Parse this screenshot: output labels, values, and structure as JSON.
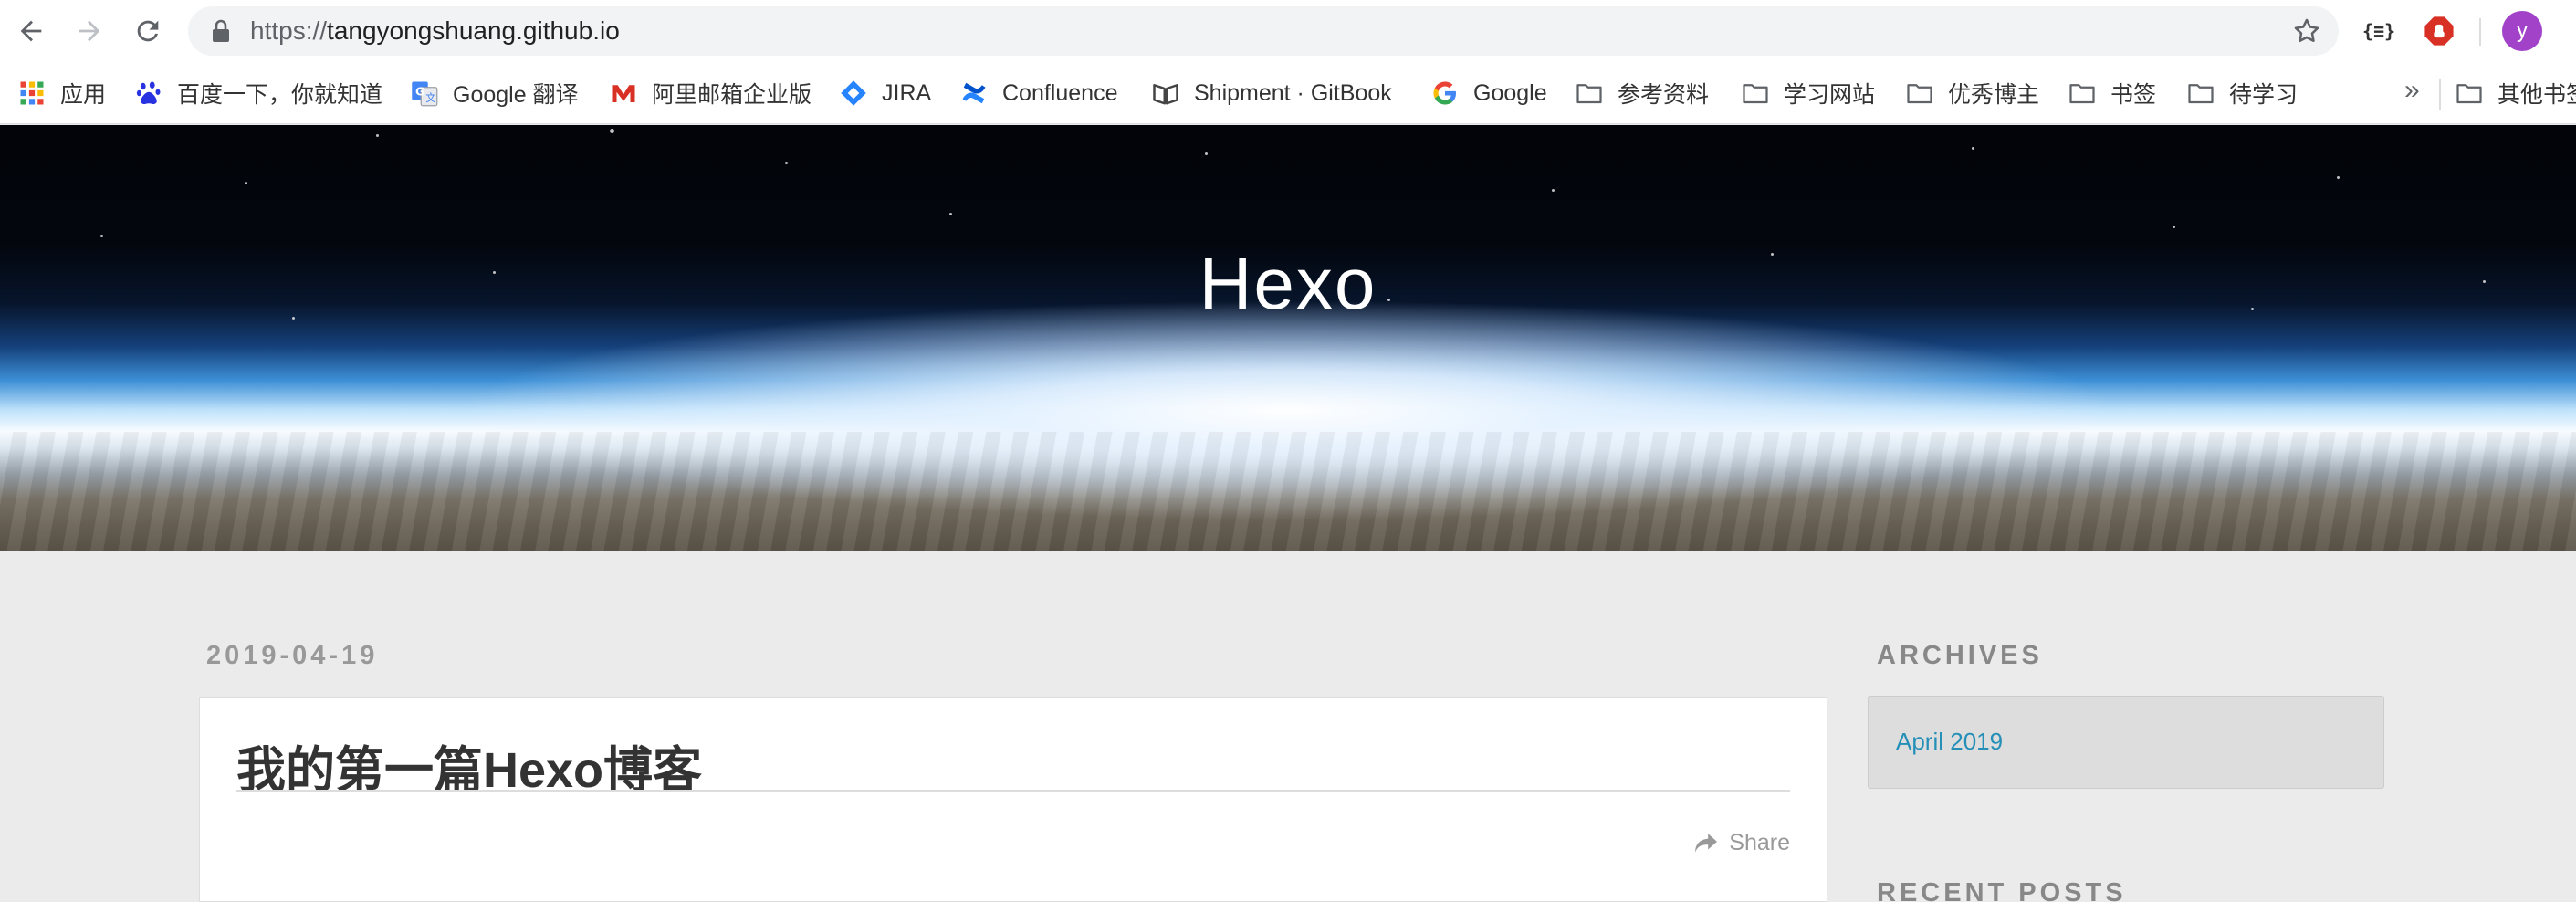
{
  "browser": {
    "url_scheme": "https://",
    "url_host": "tangyongshuang.github.io",
    "avatar_letter": "y",
    "extension_json_label": "{≡}",
    "bookmarks": [
      {
        "label": "应用",
        "icon": "apps-grid-icon"
      },
      {
        "label": "百度一下，你就知道",
        "icon": "baidu-paw-icon"
      },
      {
        "label": "Google 翻译",
        "icon": "google-translate-icon"
      },
      {
        "label": "阿里邮箱企业版",
        "icon": "aliyun-mail-icon"
      },
      {
        "label": "JIRA",
        "icon": "jira-diamond-icon"
      },
      {
        "label": "Confluence",
        "icon": "confluence-icon"
      },
      {
        "label": "Shipment · GitBook",
        "icon": "gitbook-icon"
      },
      {
        "label": "Google",
        "icon": "google-g-icon"
      },
      {
        "label": "参考资料",
        "icon": "folder-icon"
      },
      {
        "label": "学习网站",
        "icon": "folder-icon"
      },
      {
        "label": "优秀博主",
        "icon": "folder-icon"
      },
      {
        "label": "书签",
        "icon": "folder-icon"
      },
      {
        "label": "待学习",
        "icon": "folder-icon"
      }
    ],
    "more_label": "»",
    "other_bookmarks_label": "其他书签"
  },
  "site": {
    "title": "Hexo"
  },
  "post": {
    "date": "2019-04-19",
    "title": "我的第一篇Hexo博客",
    "share_label": "Share"
  },
  "sidebar": {
    "archives_title": "ARCHIVES",
    "archive_items": [
      "April 2019"
    ],
    "recent_posts_title": "RECENT POSTS"
  },
  "colors": {
    "link": "#258fb8",
    "avatar": "#a142c9",
    "page_bg": "#ebebeb"
  }
}
